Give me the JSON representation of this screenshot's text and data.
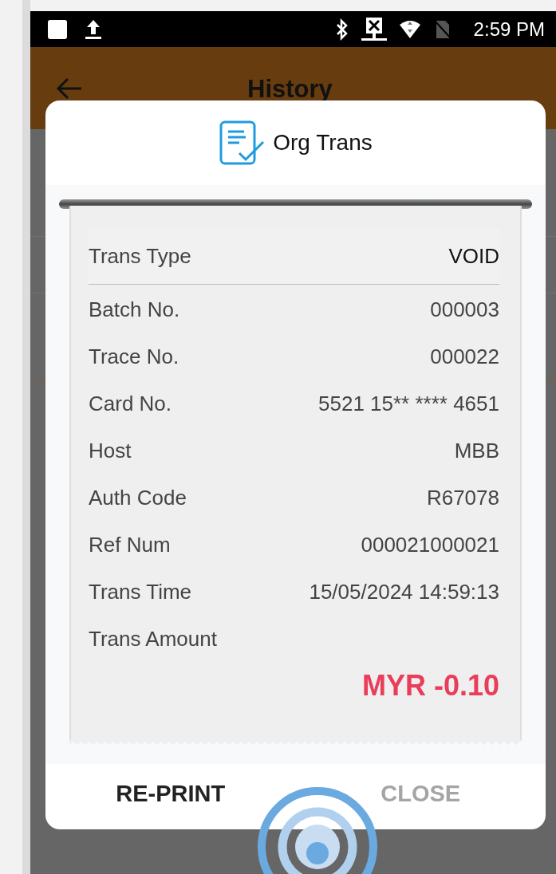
{
  "status_bar": {
    "time": "2:59 PM"
  },
  "app_bar": {
    "title": "History"
  },
  "dialog": {
    "title": "Org Trans",
    "receipt": {
      "rows": [
        {
          "kind": "header",
          "label": "Trans Type",
          "value": "VOID"
        },
        {
          "kind": "detail",
          "label": "Batch No.",
          "value": "000003"
        },
        {
          "kind": "detail",
          "label": "Trace No.",
          "value": "000022"
        },
        {
          "kind": "detail",
          "label": "Card No.",
          "value": "5521 15** **** 4651"
        },
        {
          "kind": "detail",
          "label": "Host",
          "value": "MBB"
        },
        {
          "kind": "detail",
          "label": "Auth Code",
          "value": "R67078"
        },
        {
          "kind": "detail",
          "label": "Ref Num",
          "value": "000021000021"
        },
        {
          "kind": "detail",
          "label": "Trans Time",
          "value": "15/05/2024 14:59:13"
        }
      ],
      "amount_label": "Trans Amount",
      "amount": "MYR -0.10"
    },
    "buttons": [
      {
        "label": "RE-PRINT",
        "disabled": false
      },
      {
        "label": "CLOSE",
        "disabled": true
      }
    ]
  }
}
